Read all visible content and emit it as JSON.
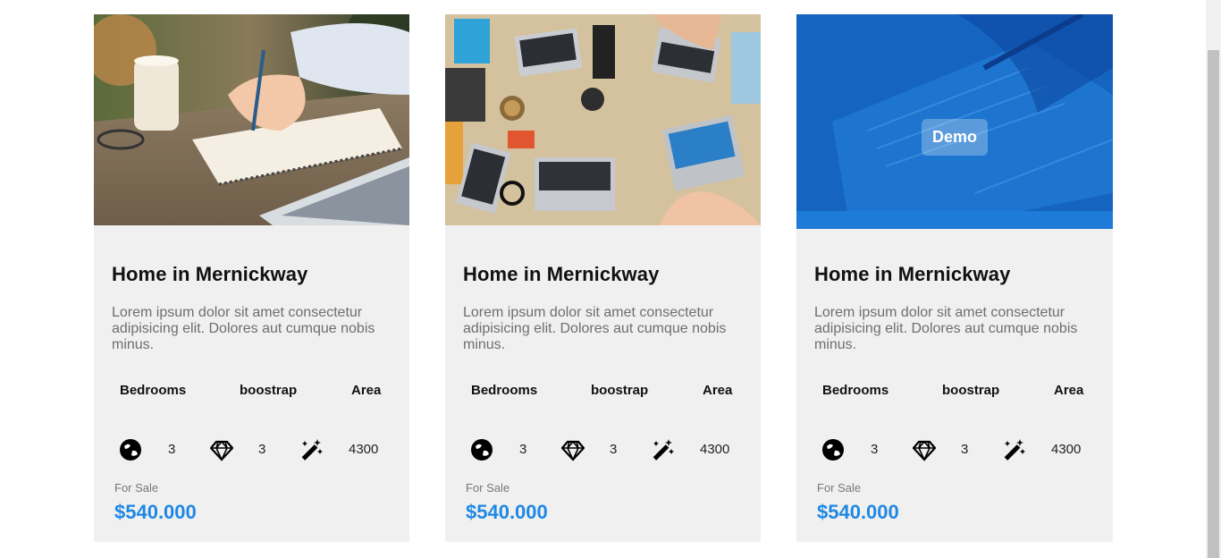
{
  "cards": [
    {
      "title": "Home in Mernickway",
      "description": "Lorem ipsum dolor sit amet consectetur adipisicing elit. Dolores aut cumque nobis minus.",
      "features": [
        {
          "label": "Bedrooms",
          "icon": "globe-icon",
          "value": "3"
        },
        {
          "label": "boostrap",
          "icon": "diamond-icon",
          "value": "3"
        },
        {
          "label": "Area",
          "icon": "magic-wand-icon",
          "value": "4300"
        }
      ],
      "status": "For Sale",
      "price": "$540.000",
      "image": "photo-notebook-writing"
    },
    {
      "title": "Home in Mernickway",
      "description": "Lorem ipsum dolor sit amet consectetur adipisicing elit. Dolores aut cumque nobis minus.",
      "features": [
        {
          "label": "Bedrooms",
          "icon": "globe-icon",
          "value": "3"
        },
        {
          "label": "boostrap",
          "icon": "diamond-icon",
          "value": "3"
        },
        {
          "label": "Area",
          "icon": "magic-wand-icon",
          "value": "4300"
        }
      ],
      "status": "For Sale",
      "price": "$540.000",
      "image": "photo-laptops-table"
    },
    {
      "title": "Home in Mernickway",
      "description": "Lorem ipsum dolor sit amet consectetur adipisicing elit. Dolores aut cumque nobis minus.",
      "features": [
        {
          "label": "Bedrooms",
          "icon": "globe-icon",
          "value": "3"
        },
        {
          "label": "boostrap",
          "icon": "diamond-icon",
          "value": "3"
        },
        {
          "label": "Area",
          "icon": "magic-wand-icon",
          "value": "4300"
        }
      ],
      "status": "For Sale",
      "price": "$540.000",
      "image": "photo-documents-blue-overlay",
      "overlay_label": "Demo"
    }
  ],
  "colors": {
    "card_bg": "#f0f0f0",
    "price": "#1e88e5",
    "overlay": "#1565c0"
  }
}
